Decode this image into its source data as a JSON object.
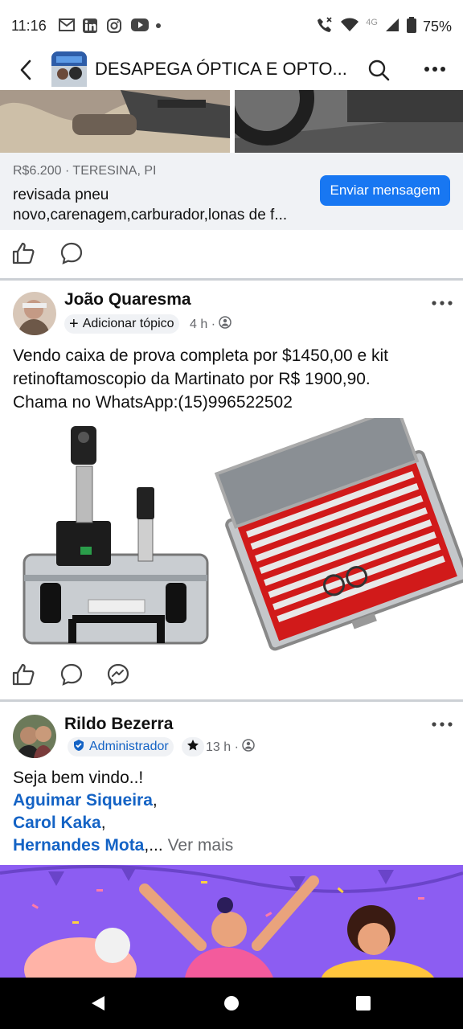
{
  "status_bar": {
    "time": "11:16",
    "notif_icons": [
      "gmail-icon",
      "linkedin-icon",
      "instagram-icon",
      "youtube-icon"
    ],
    "network_label": "4G",
    "battery": "75%"
  },
  "app_bar": {
    "group_title": "DESAPEGA ÓPTICA E OPTO..."
  },
  "listing": {
    "price_location": "R$6.200 · TERESINA, PI",
    "description_line1": "revisada pneu",
    "description_line2": "novo,carenagem,carburador,lonas de f...",
    "send_button": "Enviar mensagem"
  },
  "post1": {
    "author": "João Quaresma",
    "topic_button": "Adicionar tópico",
    "time": "4 h ·",
    "text_line1": "Vendo caixa de prova completa por $1450,00 e  kit",
    "text_line2": "retinoftamoscopio da Martinato por R$ 1900,90.",
    "text_line3": "Chama no WhatsApp:(15)996522502"
  },
  "post2": {
    "author": "Rildo Bezerra",
    "badge": "Administrador",
    "time": "13 h ·",
    "text_line1": "Seja bem vindo..!",
    "mention1": "Aguimar Siqueira",
    "sep1": ",",
    "mention2": "Carol Kaka",
    "sep2": ",",
    "mention3": "Hernandes Mota",
    "ellipsis": ",...",
    "see_more": "Ver mais"
  },
  "colors": {
    "accent": "#1877f2",
    "link": "#1463c5",
    "muted": "#65676b",
    "divider": "#ccd0d5",
    "banner": "#8a5cf0"
  }
}
